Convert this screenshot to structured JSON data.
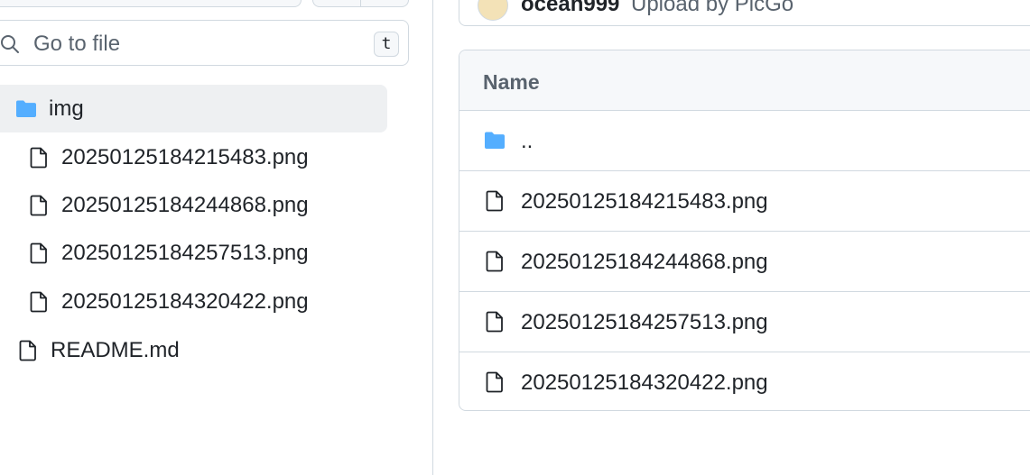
{
  "colors": {
    "border": "#d1d9e0",
    "muted_text": "#59636e",
    "text": "#1f2328",
    "folder_blue": "#54aeff",
    "selected_bg": "#eef0f2",
    "header_bg": "#f6f8fa"
  },
  "search": {
    "placeholder": "Go to file",
    "shortcut": "t",
    "icon": "search-icon"
  },
  "tree": {
    "items": [
      {
        "label": "img",
        "icon": "folder-icon",
        "selected": true
      },
      {
        "label": "20250125184215483.png",
        "icon": "file-icon"
      },
      {
        "label": "20250125184244868.png",
        "icon": "file-icon"
      },
      {
        "label": "20250125184257513.png",
        "icon": "file-icon"
      },
      {
        "label": "20250125184320422.png",
        "icon": "file-icon"
      },
      {
        "label": "README.md",
        "icon": "file-icon"
      }
    ]
  },
  "commit": {
    "author": "ocean999",
    "message": "Upload by PicGo"
  },
  "file_table": {
    "header": "Name",
    "rows": [
      {
        "label": "..",
        "icon": "folder-icon"
      },
      {
        "label": "20250125184215483.png",
        "icon": "file-icon"
      },
      {
        "label": "20250125184244868.png",
        "icon": "file-icon"
      },
      {
        "label": "20250125184257513.png",
        "icon": "file-icon"
      },
      {
        "label": "20250125184320422.png",
        "icon": "file-icon"
      }
    ]
  }
}
